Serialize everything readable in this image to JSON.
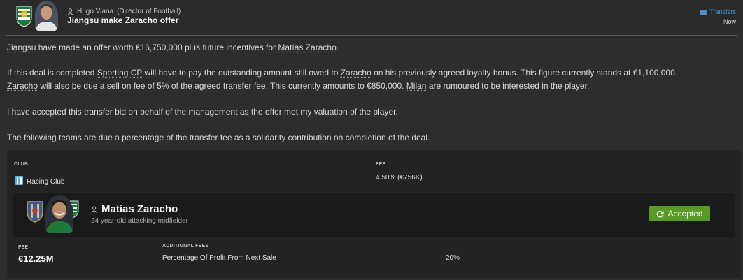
{
  "header": {
    "sender_name": "Hugo Viana",
    "sender_role": "(Director of Football)",
    "headline": "Jiangsu make Zaracho offer",
    "tag": "Transfers",
    "time": "Now"
  },
  "body": {
    "p1": [
      "Jiangsu",
      " have made an offer worth €16,750,000 plus future incentives for ",
      "Matías Zaracho",
      "."
    ],
    "p2a": [
      "If this deal is completed ",
      "Sporting CP",
      " will have to pay the outstanding amount still owed to ",
      "Zaracho",
      " on his previously agreed loyalty bonus. This figure currently stands at €1,100,000."
    ],
    "p2b": [
      "Zaracho",
      " will also be due a sell on fee of 5% of the agreed transfer fee. This currently amounts to €850,000. ",
      "Milan",
      " are rumoured to be interested in the player."
    ],
    "p3": "I have accepted this transfer bid on behalf of the management as the offer met my valuation of the player.",
    "p4": "The following teams are due a percentage of the transfer fee as a solidarity contribution on completion of the deal."
  },
  "solidarity": {
    "club_header": "CLUB",
    "fee_header": "FEE",
    "club": "Racing Club",
    "fee": "4.50% (€756K)"
  },
  "player": {
    "name": "Matías Zaracho",
    "description": "24 year-old attacking midfielder",
    "status": "Accepted"
  },
  "deal": {
    "fee_label": "FEE",
    "fee": "€12.25M",
    "additional_label": "ADDITIONAL FEES",
    "additional_item": "Percentage Of Profit From Next Sale",
    "additional_value": "20%"
  },
  "colors": {
    "accent_blue": "#4b8fc9",
    "accepted_green": "#5a9a26",
    "sporting_green": "#1f7a3a"
  }
}
